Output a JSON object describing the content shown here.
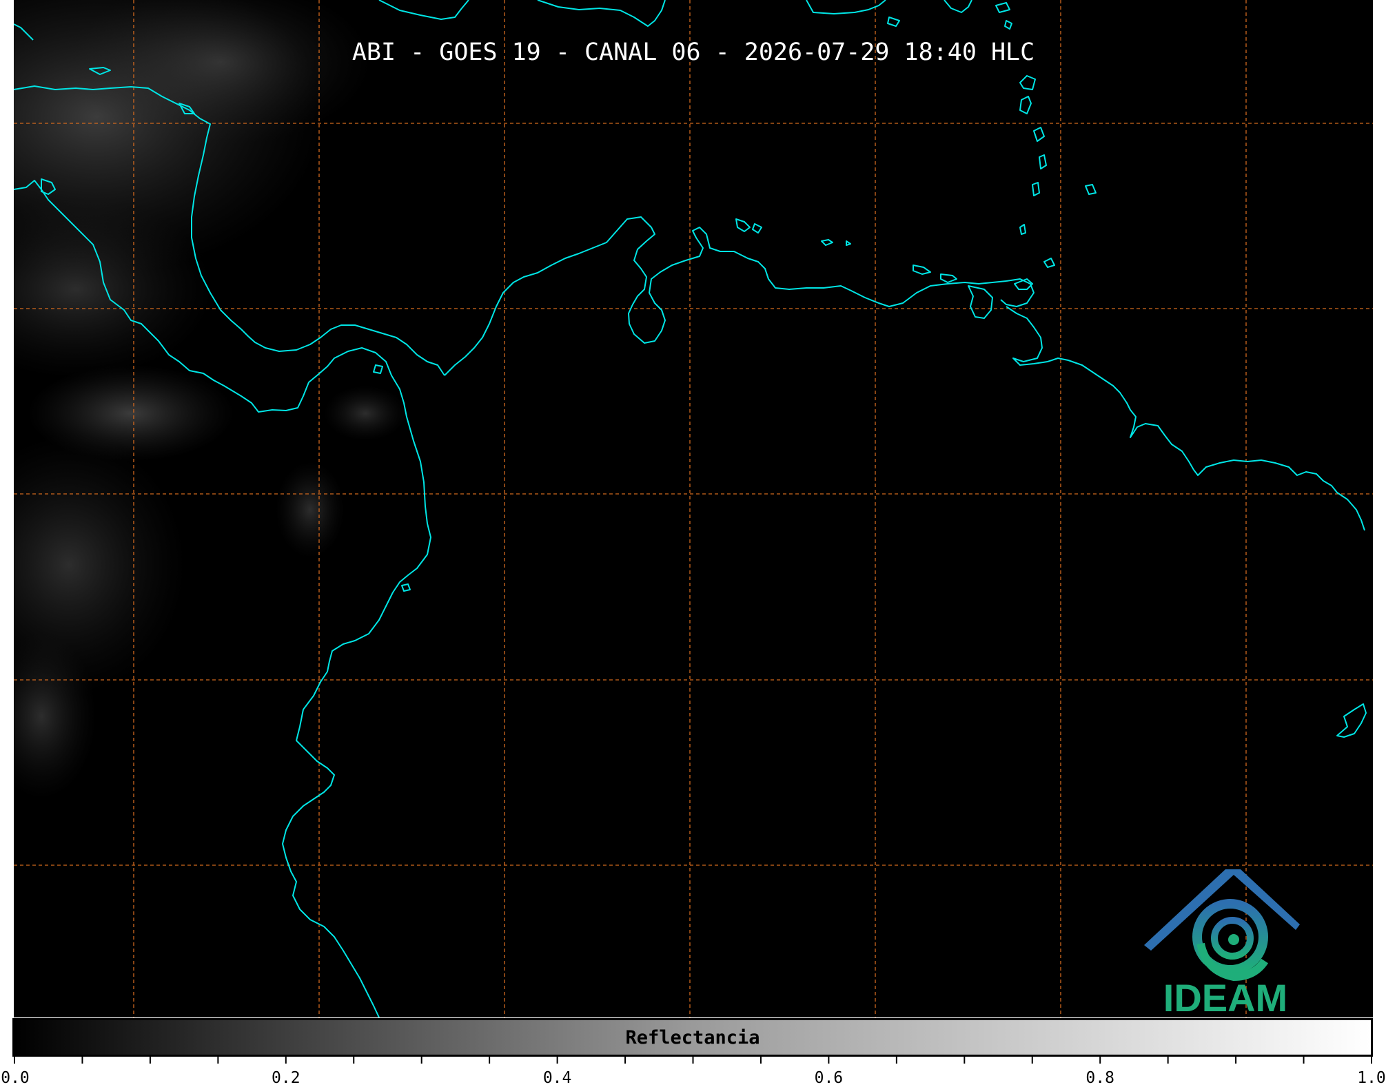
{
  "map": {
    "title": "ABI - GOES 19 - CANAL 06 - 2026-07-29 18:40 HLC",
    "colors": {
      "background": "#000000",
      "coastline": "#00e5e5",
      "graticule": "#d2691e",
      "cloud_haze": "#7a7a7a"
    },
    "logo": {
      "text": "IDEAM",
      "text_color": "#1fae7a",
      "mark_colors": [
        "#2d6fb0",
        "#1fae7a"
      ]
    }
  },
  "colorbar": {
    "label": "Reflectancia",
    "colormap": "grayscale",
    "range": [
      0.0,
      1.0
    ],
    "ticks": [
      {
        "value": 0.0,
        "label": "0.0"
      },
      {
        "value": 0.2,
        "label": "0.2"
      },
      {
        "value": 0.4,
        "label": "0.4"
      },
      {
        "value": 0.6,
        "label": "0.6"
      },
      {
        "value": 0.8,
        "label": "0.8"
      },
      {
        "value": 1.0,
        "label": "1.0"
      }
    ],
    "minor_step": 0.05
  }
}
